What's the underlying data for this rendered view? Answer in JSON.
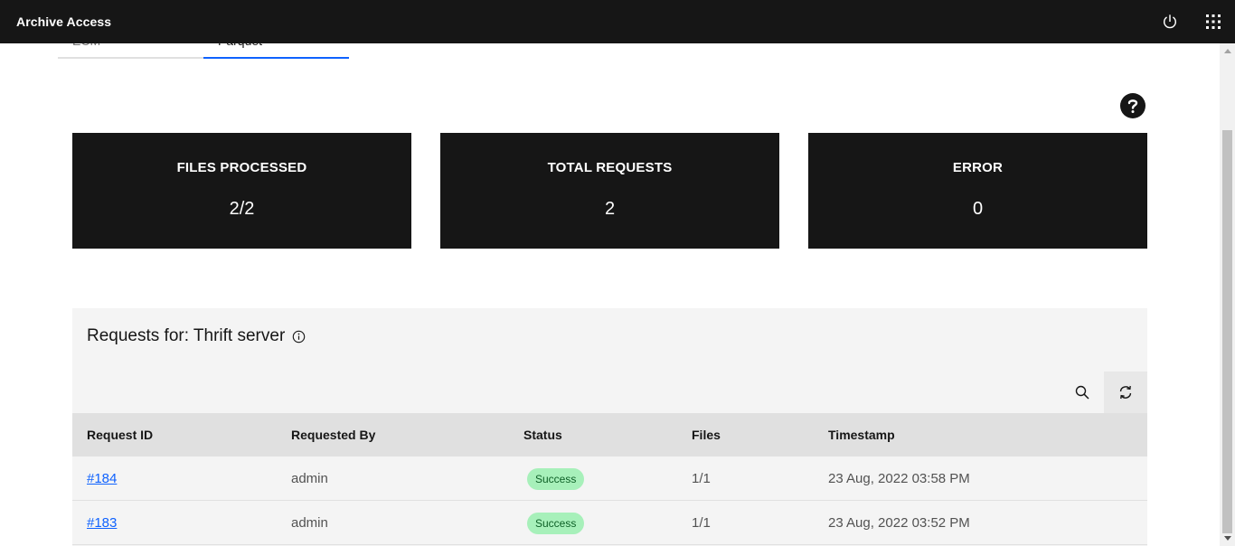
{
  "header": {
    "title": "Archive Access"
  },
  "tabs": [
    {
      "label": "ECM",
      "active": false
    },
    {
      "label": "Parquet",
      "active": true
    }
  ],
  "cards": [
    {
      "label": "FILES PROCESSED",
      "value": "2/2"
    },
    {
      "label": "TOTAL REQUESTS",
      "value": "2"
    },
    {
      "label": "ERROR",
      "value": "0"
    }
  ],
  "panel": {
    "title": "Requests for: Thrift server"
  },
  "table": {
    "columns": [
      "Request ID",
      "Requested By",
      "Status",
      "Files",
      "Timestamp"
    ],
    "rows": [
      {
        "id": "#184",
        "by": "admin",
        "status": "Success",
        "files": "1/1",
        "timestamp": "23 Aug, 2022 03:58 PM"
      },
      {
        "id": "#183",
        "by": "admin",
        "status": "Success",
        "files": "1/1",
        "timestamp": "23 Aug, 2022 03:52 PM"
      }
    ]
  },
  "icons": {
    "power": "power-icon",
    "apps": "app-switcher-icon",
    "help": "help-icon",
    "info": "info-icon",
    "search": "search-icon",
    "refresh": "refresh-icon"
  },
  "colors": {
    "header_bg": "#161616",
    "card_bg": "#161616",
    "link": "#0f62fe",
    "success_bg": "#a7f0ba",
    "success_text": "#0e6027",
    "tab_active": "#0f62fe"
  }
}
